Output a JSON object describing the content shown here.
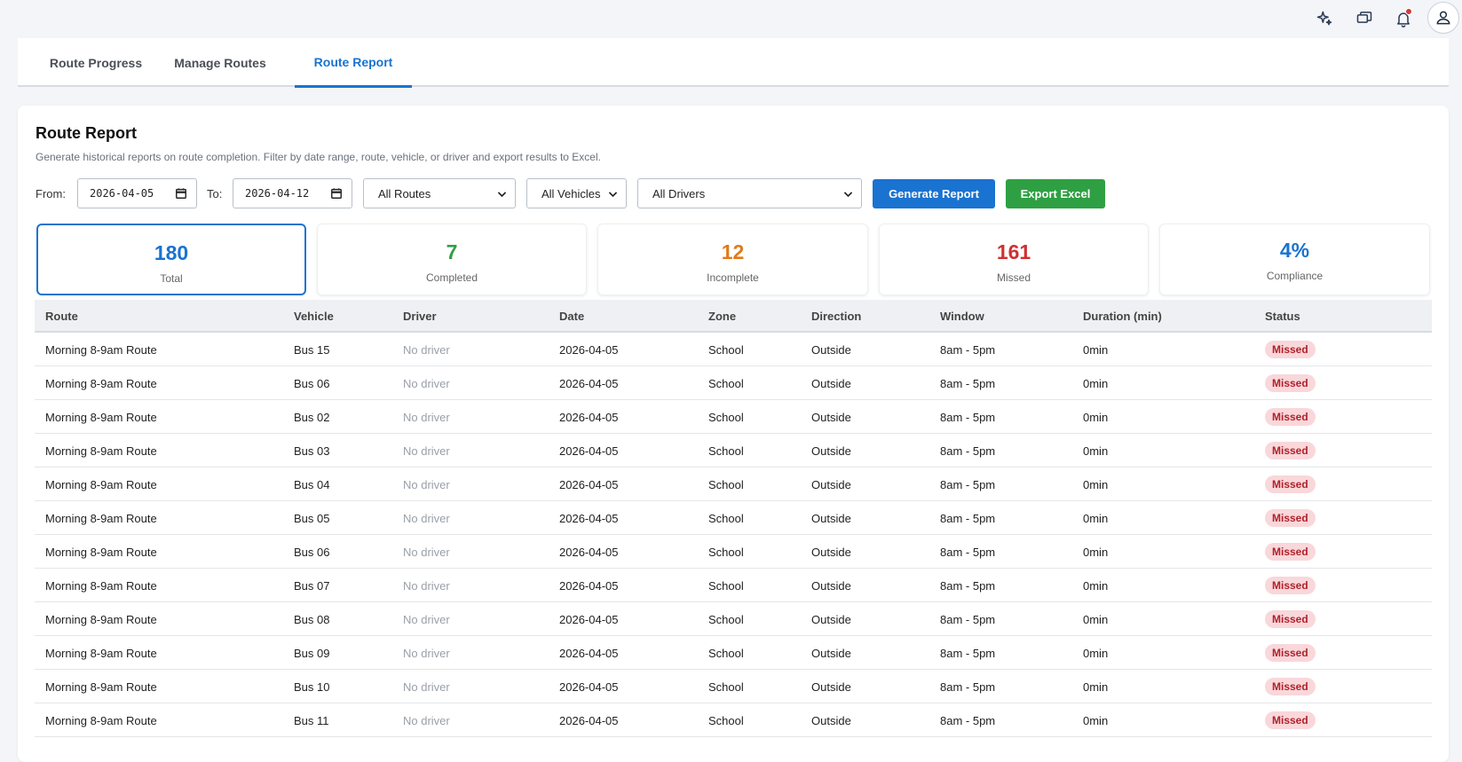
{
  "topbar": {
    "icons": [
      "sparkle-icon",
      "chat-icon",
      "bell-icon",
      "user-icon"
    ]
  },
  "tabs": [
    {
      "label": "Route Progress"
    },
    {
      "label": "Manage Routes"
    },
    {
      "label": "Route Report",
      "active": true
    }
  ],
  "report": {
    "title": "Route Report",
    "subtitle": "Generate historical reports on route completion. Filter by date range, route, vehicle, or driver and export results to Excel."
  },
  "filters": {
    "from_label": "From:",
    "from_value": "2026-04-05",
    "to_label": "To:",
    "to_value": "2026-04-12",
    "route": "All Routes",
    "vehicle": "All Vehicles",
    "driver": "All Drivers",
    "generate_label": "Generate Report",
    "export_label": "Export Excel"
  },
  "stats": [
    {
      "value": "180",
      "label": "Total",
      "color": "#1a73d0"
    },
    {
      "value": "7",
      "label": "Completed",
      "color": "#2ea043"
    },
    {
      "value": "12",
      "label": "Incomplete",
      "color": "#e07b1a"
    },
    {
      "value": "161",
      "label": "Missed",
      "color": "#d0302f"
    },
    {
      "value": "4%",
      "label": "Compliance",
      "color": "#1a73d0"
    }
  ],
  "table": {
    "columns": [
      "Route",
      "Vehicle",
      "Driver",
      "Date",
      "Zone",
      "Direction",
      "Window",
      "Duration (min)",
      "Status"
    ],
    "rows": [
      [
        "Morning 8-9am Route",
        "Bus 15",
        "No driver",
        "2026-04-05",
        "School",
        "Outside",
        "8am - 5pm",
        "0min",
        "Missed"
      ],
      [
        "Morning 8-9am Route",
        "Bus 06",
        "No driver",
        "2026-04-05",
        "School",
        "Outside",
        "8am - 5pm",
        "0min",
        "Missed"
      ],
      [
        "Morning 8-9am Route",
        "Bus 02",
        "No driver",
        "2026-04-05",
        "School",
        "Outside",
        "8am - 5pm",
        "0min",
        "Missed"
      ],
      [
        "Morning 8-9am Route",
        "Bus 03",
        "No driver",
        "2026-04-05",
        "School",
        "Outside",
        "8am - 5pm",
        "0min",
        "Missed"
      ],
      [
        "Morning 8-9am Route",
        "Bus 04",
        "No driver",
        "2026-04-05",
        "School",
        "Outside",
        "8am - 5pm",
        "0min",
        "Missed"
      ],
      [
        "Morning 8-9am Route",
        "Bus 05",
        "No driver",
        "2026-04-05",
        "School",
        "Outside",
        "8am - 5pm",
        "0min",
        "Missed"
      ],
      [
        "Morning 8-9am Route",
        "Bus 06",
        "No driver",
        "2026-04-05",
        "School",
        "Outside",
        "8am - 5pm",
        "0min",
        "Missed"
      ],
      [
        "Morning 8-9am Route",
        "Bus 07",
        "No driver",
        "2026-04-05",
        "School",
        "Outside",
        "8am - 5pm",
        "0min",
        "Missed"
      ],
      [
        "Morning 8-9am Route",
        "Bus 08",
        "No driver",
        "2026-04-05",
        "School",
        "Outside",
        "8am - 5pm",
        "0min",
        "Missed"
      ],
      [
        "Morning 8-9am Route",
        "Bus 09",
        "No driver",
        "2026-04-05",
        "School",
        "Outside",
        "8am - 5pm",
        "0min",
        "Missed"
      ],
      [
        "Morning 8-9am Route",
        "Bus 10",
        "No driver",
        "2026-04-05",
        "School",
        "Outside",
        "8am - 5pm",
        "0min",
        "Missed"
      ],
      [
        "Morning 8-9am Route",
        "Bus 11",
        "No driver",
        "2026-04-05",
        "School",
        "Outside",
        "8am - 5pm",
        "0min",
        "Missed"
      ]
    ]
  }
}
